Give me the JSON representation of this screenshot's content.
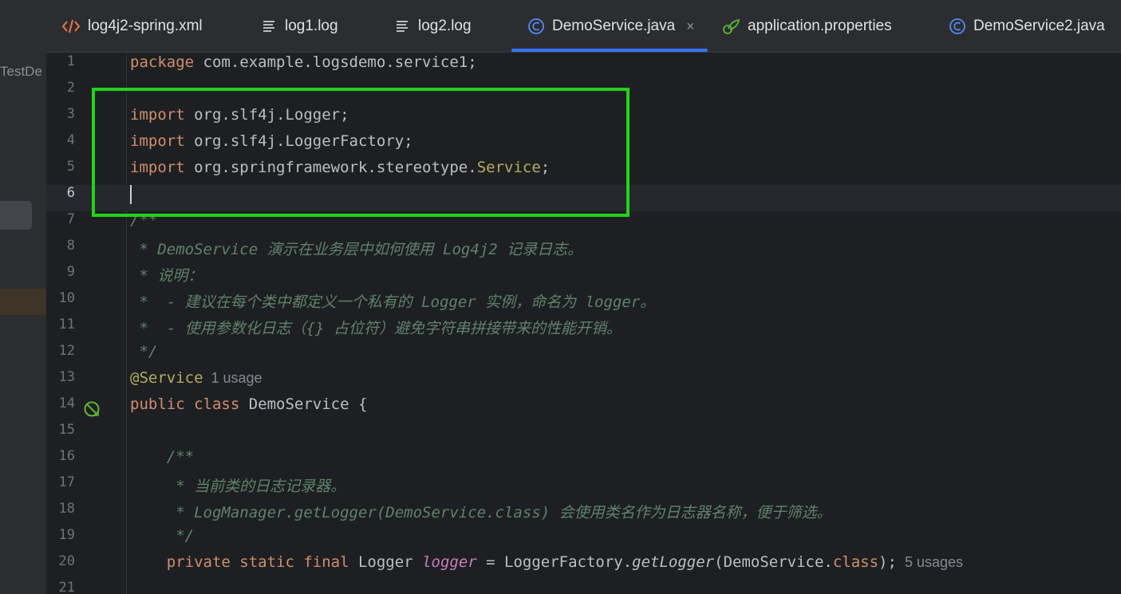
{
  "left_panel": {
    "project_label": "TestDe"
  },
  "tabs": [
    {
      "label": "log4j2-spring.xml",
      "icon": "xml-icon",
      "active": false
    },
    {
      "label": "log1.log",
      "icon": "text-file-icon",
      "active": false
    },
    {
      "label": "log2.log",
      "icon": "text-file-icon",
      "active": false
    },
    {
      "label": "DemoService.java",
      "icon": "java-class-icon",
      "active": true
    },
    {
      "label": "application.properties",
      "icon": "spring-properties-icon",
      "active": false
    },
    {
      "label": "DemoService2.java",
      "icon": "java-class-icon",
      "active": false
    }
  ],
  "close_glyph": "×",
  "editor": {
    "current_line": 6,
    "lines": [
      {
        "n": "1",
        "tokens": [
          {
            "t": "package",
            "c": "kw"
          },
          {
            "t": " com.example.logsdemo.service1;",
            "c": "plain"
          }
        ]
      },
      {
        "n": "2",
        "tokens": []
      },
      {
        "n": "3",
        "tokens": [
          {
            "t": "import",
            "c": "kw"
          },
          {
            "t": " org.slf4j.Logger;",
            "c": "plain"
          }
        ]
      },
      {
        "n": "4",
        "tokens": [
          {
            "t": "import",
            "c": "kw"
          },
          {
            "t": " org.slf4j.LoggerFactory;",
            "c": "plain"
          }
        ]
      },
      {
        "n": "5",
        "tokens": [
          {
            "t": "import",
            "c": "kw"
          },
          {
            "t": " org.springframework.stereotype.",
            "c": "plain"
          },
          {
            "t": "Service",
            "c": "ann"
          },
          {
            "t": ";",
            "c": "plain"
          }
        ]
      },
      {
        "n": "6",
        "tokens": [],
        "caret": true
      },
      {
        "n": "7",
        "tokens": [
          {
            "t": "/**",
            "c": "cmt"
          }
        ]
      },
      {
        "n": "8",
        "tokens": [
          {
            "t": " * DemoService 演示在业务层中如何使用 Log4j2 记录日志。",
            "c": "cmt"
          }
        ]
      },
      {
        "n": "9",
        "tokens": [
          {
            "t": " * 说明：",
            "c": "cmt"
          }
        ]
      },
      {
        "n": "10",
        "tokens": [
          {
            "t": " *  - 建议在每个类中都定义一个私有的 Logger 实例，命名为 logger。",
            "c": "cmt"
          }
        ]
      },
      {
        "n": "11",
        "tokens": [
          {
            "t": " *  - 使用参数化日志（{} 占位符）避免字符串拼接带来的性能开销。",
            "c": "cmt"
          }
        ]
      },
      {
        "n": "12",
        "tokens": [
          {
            "t": " */",
            "c": "cmt"
          }
        ]
      },
      {
        "n": "13",
        "tokens": [
          {
            "t": "@Service",
            "c": "ann"
          },
          {
            "t": "  1 usage",
            "c": "hint"
          }
        ]
      },
      {
        "n": "14",
        "tokens": [
          {
            "t": "public class",
            "c": "kw"
          },
          {
            "t": " DemoService ",
            "c": "cls"
          },
          {
            "t": "{",
            "c": "plain"
          }
        ],
        "gutter_icon": "spring-bean-icon"
      },
      {
        "n": "15",
        "tokens": []
      },
      {
        "n": "16",
        "tokens": [
          {
            "t": "    /**",
            "c": "cmt"
          }
        ]
      },
      {
        "n": "17",
        "tokens": [
          {
            "t": "     * 当前类的日志记录器。",
            "c": "cmt"
          }
        ]
      },
      {
        "n": "18",
        "tokens": [
          {
            "t": "     * LogManager.getLogger(DemoService.class) 会使用类名作为日志器名称，便于筛选。",
            "c": "cmt"
          }
        ]
      },
      {
        "n": "19",
        "tokens": [
          {
            "t": "     */",
            "c": "cmt"
          }
        ]
      },
      {
        "n": "20",
        "tokens": [
          {
            "t": "    private static final",
            "c": "kw"
          },
          {
            "t": " Logger ",
            "c": "plain"
          },
          {
            "t": "logger",
            "c": "fld"
          },
          {
            "t": " = LoggerFactory.",
            "c": "plain"
          },
          {
            "t": "getLogger",
            "c": "mcall"
          },
          {
            "t": "(DemoService.",
            "c": "plain"
          },
          {
            "t": "class",
            "c": "kw"
          },
          {
            "t": ");",
            "c": "plain"
          },
          {
            "t": "  5 usages",
            "c": "hint"
          }
        ]
      },
      {
        "n": "21",
        "tokens": []
      }
    ]
  },
  "colors": {
    "accent": "#3574f0",
    "highlight": "#22d31a"
  }
}
